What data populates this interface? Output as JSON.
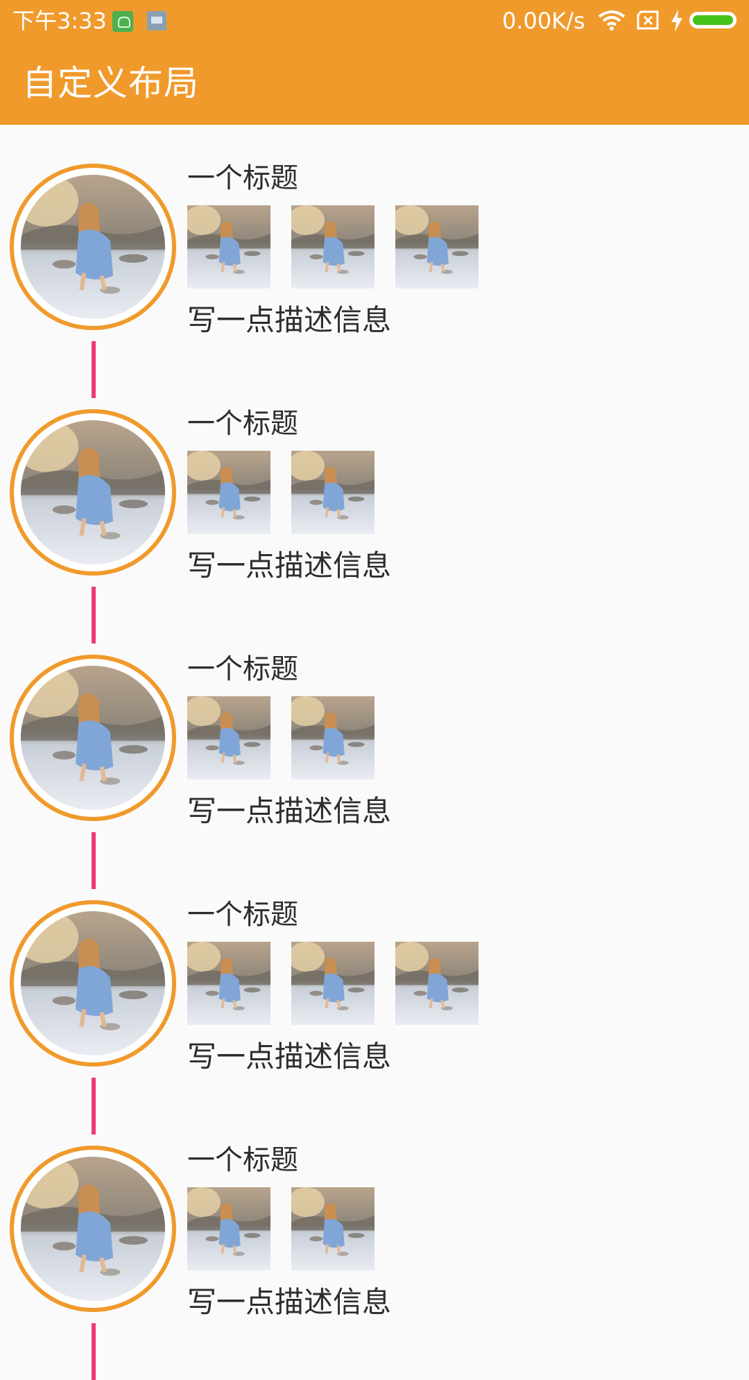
{
  "status_bar": {
    "time": "下午3:33",
    "network_speed": "0.00K/s",
    "icons": [
      "app-notification-icon",
      "message-notification-icon",
      "wifi-icon",
      "no-sim-icon",
      "charging-icon",
      "battery-icon"
    ],
    "battery_color": "#45c21a"
  },
  "app_bar": {
    "title": "自定义布局",
    "color": "#f09a2c"
  },
  "timeline": {
    "connector_color": "#ee3a74",
    "avatar_border_color": "#f09a2c",
    "items": [
      {
        "title": "一个标题",
        "image_count": 3,
        "description": "写一点描述信息"
      },
      {
        "title": "一个标题",
        "image_count": 2,
        "description": "写一点描述信息"
      },
      {
        "title": "一个标题",
        "image_count": 2,
        "description": "写一点描述信息"
      },
      {
        "title": "一个标题",
        "image_count": 3,
        "description": "写一点描述信息"
      },
      {
        "title": "一个标题",
        "image_count": 2,
        "description": "写一点描述信息"
      }
    ]
  }
}
